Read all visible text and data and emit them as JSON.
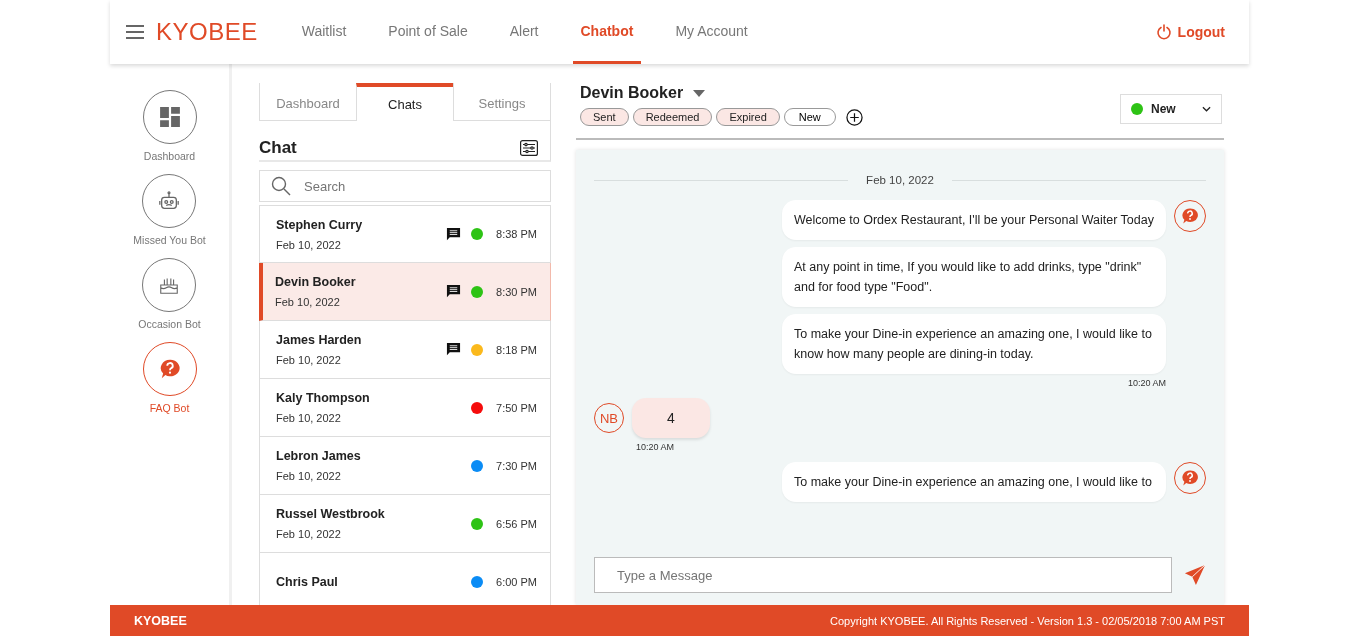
{
  "header": {
    "logo": "KYOBEE",
    "nav": [
      {
        "label": "Waitlist",
        "selected": false
      },
      {
        "label": "Point of Sale",
        "selected": false
      },
      {
        "label": "Alert",
        "selected": false
      },
      {
        "label": "Chatbot",
        "selected": true
      },
      {
        "label": "My Account",
        "selected": false
      }
    ],
    "logout": "Logout"
  },
  "sidebar": {
    "items": [
      {
        "kind": "dashboard",
        "label": "Dashboard",
        "selected": false
      },
      {
        "kind": "robot",
        "label": "Missed You Bot",
        "selected": false
      },
      {
        "kind": "cake",
        "label": "Occasion Bot",
        "selected": false
      },
      {
        "kind": "faq",
        "label": "FAQ Bot",
        "selected": true
      }
    ]
  },
  "tabs": [
    {
      "label": "Dashboard",
      "selected": false
    },
    {
      "label": "Chats",
      "selected": true
    },
    {
      "label": "Settings",
      "selected": false
    }
  ],
  "chat_list": {
    "title": "Chat",
    "search": {
      "placeholder": "Search"
    },
    "rows": [
      {
        "name": "Stephen Curry",
        "date": "Feb 10, 2022",
        "message_icon": true,
        "color": "#2ec315",
        "time": "8:38 PM",
        "selected": false
      },
      {
        "name": "Devin Booker",
        "date": "Feb 10, 2022",
        "message_icon": true,
        "color": "#2ec315",
        "time": "8:30 PM",
        "selected": true
      },
      {
        "name": "James Harden",
        "date": "Feb 10, 2022",
        "message_icon": true,
        "color": "#fbb91c",
        "time": "8:18 PM",
        "selected": false
      },
      {
        "name": "Kaly Thompson",
        "date": "Feb 10, 2022",
        "message_icon": false,
        "color": "#f50c0c",
        "time": "7:50 PM",
        "selected": false
      },
      {
        "name": "Lebron James",
        "date": "Feb 10, 2022",
        "message_icon": false,
        "color": "#0b8cf5",
        "time": "7:30 PM",
        "selected": false
      },
      {
        "name": "Russel Westbrook",
        "date": "Feb 10, 2022",
        "message_icon": false,
        "color": "#2ec315",
        "time": "6:56 PM",
        "selected": false
      },
      {
        "name": "Chris Paul",
        "message_icon": false,
        "color": "#0b8cf5",
        "time": "6:00 PM",
        "selected": false
      }
    ]
  },
  "conversation": {
    "contact": "Devin Booker",
    "tags": [
      {
        "kind": "tag",
        "label": "Sent"
      },
      {
        "kind": "tag",
        "label": "Redeemed"
      },
      {
        "kind": "tag",
        "label": "Expired"
      },
      {
        "kind": "input",
        "value": "New"
      }
    ],
    "status": {
      "label": "New",
      "color": "#2ec315"
    },
    "date_divider": "Feb 10, 2022",
    "messages": [
      {
        "kind": "bot",
        "bubbles": [
          "Welcome to Ordex Restaurant, I'll be your Personal Waiter Today",
          "At any point in time, If you would like to add drinks, type \"drink\" and for food type \"Food\".",
          "To make your Dine-in experience an amazing one, I would like to know how many people are dining-in today."
        ],
        "time": "10:20 AM"
      },
      {
        "kind": "user",
        "avatar": "NB",
        "bubbles": [
          "4"
        ],
        "time": "10:20 AM"
      },
      {
        "kind": "bot",
        "bubbles": [
          "To make your Dine-in experience an amazing one, I would like to"
        ]
      }
    ],
    "composer": {
      "placeholder": "Type a Message"
    }
  },
  "footer": {
    "brand": "KYOBEE",
    "copyright": "Copyright KYOBEE. All Rights Reserved - Version 1.3 - 02/05/2018 7:00 AM PST"
  }
}
